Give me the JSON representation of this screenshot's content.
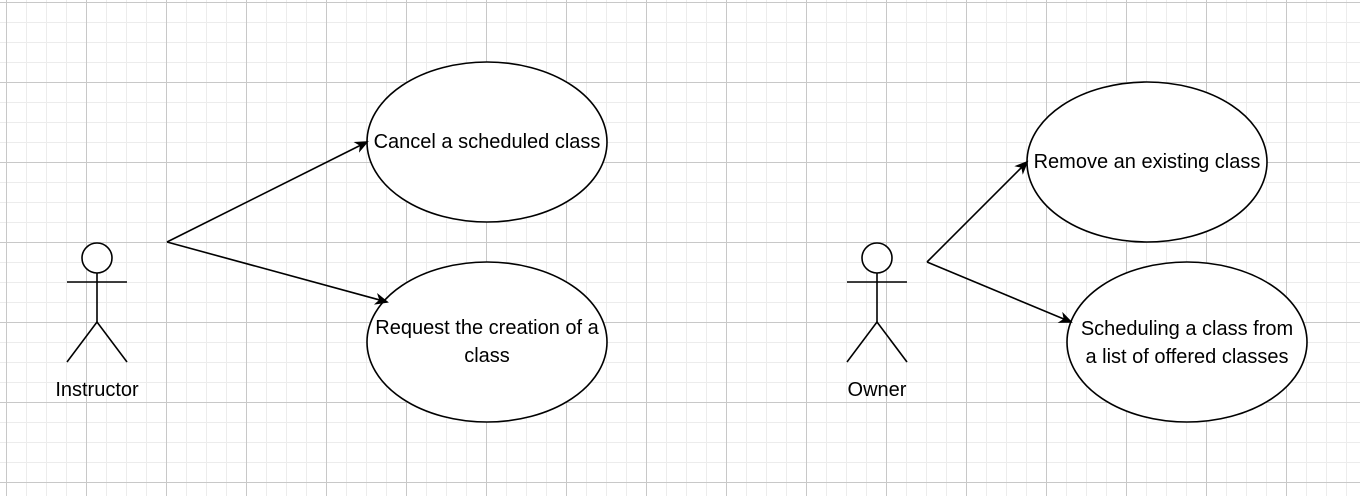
{
  "actors": [
    {
      "id": "instructor",
      "label": "Instructor"
    },
    {
      "id": "owner",
      "label": "Owner"
    }
  ],
  "use_cases": [
    {
      "id": "cancel",
      "label": "Cancel a scheduled class"
    },
    {
      "id": "request",
      "label": "Request the creation of a class"
    },
    {
      "id": "remove",
      "label": "Remove an existing class"
    },
    {
      "id": "scheduling",
      "label": "Scheduling a class from a list of offered classes"
    }
  ],
  "associations": [
    {
      "from": "instructor",
      "to": "cancel"
    },
    {
      "from": "instructor",
      "to": "request"
    },
    {
      "from": "owner",
      "to": "remove"
    },
    {
      "from": "owner",
      "to": "scheduling"
    }
  ],
  "colors": {
    "stroke": "#000000",
    "fill": "#ffffff",
    "grid_major": "#c8c8c8",
    "grid_minor": "#ececec"
  }
}
